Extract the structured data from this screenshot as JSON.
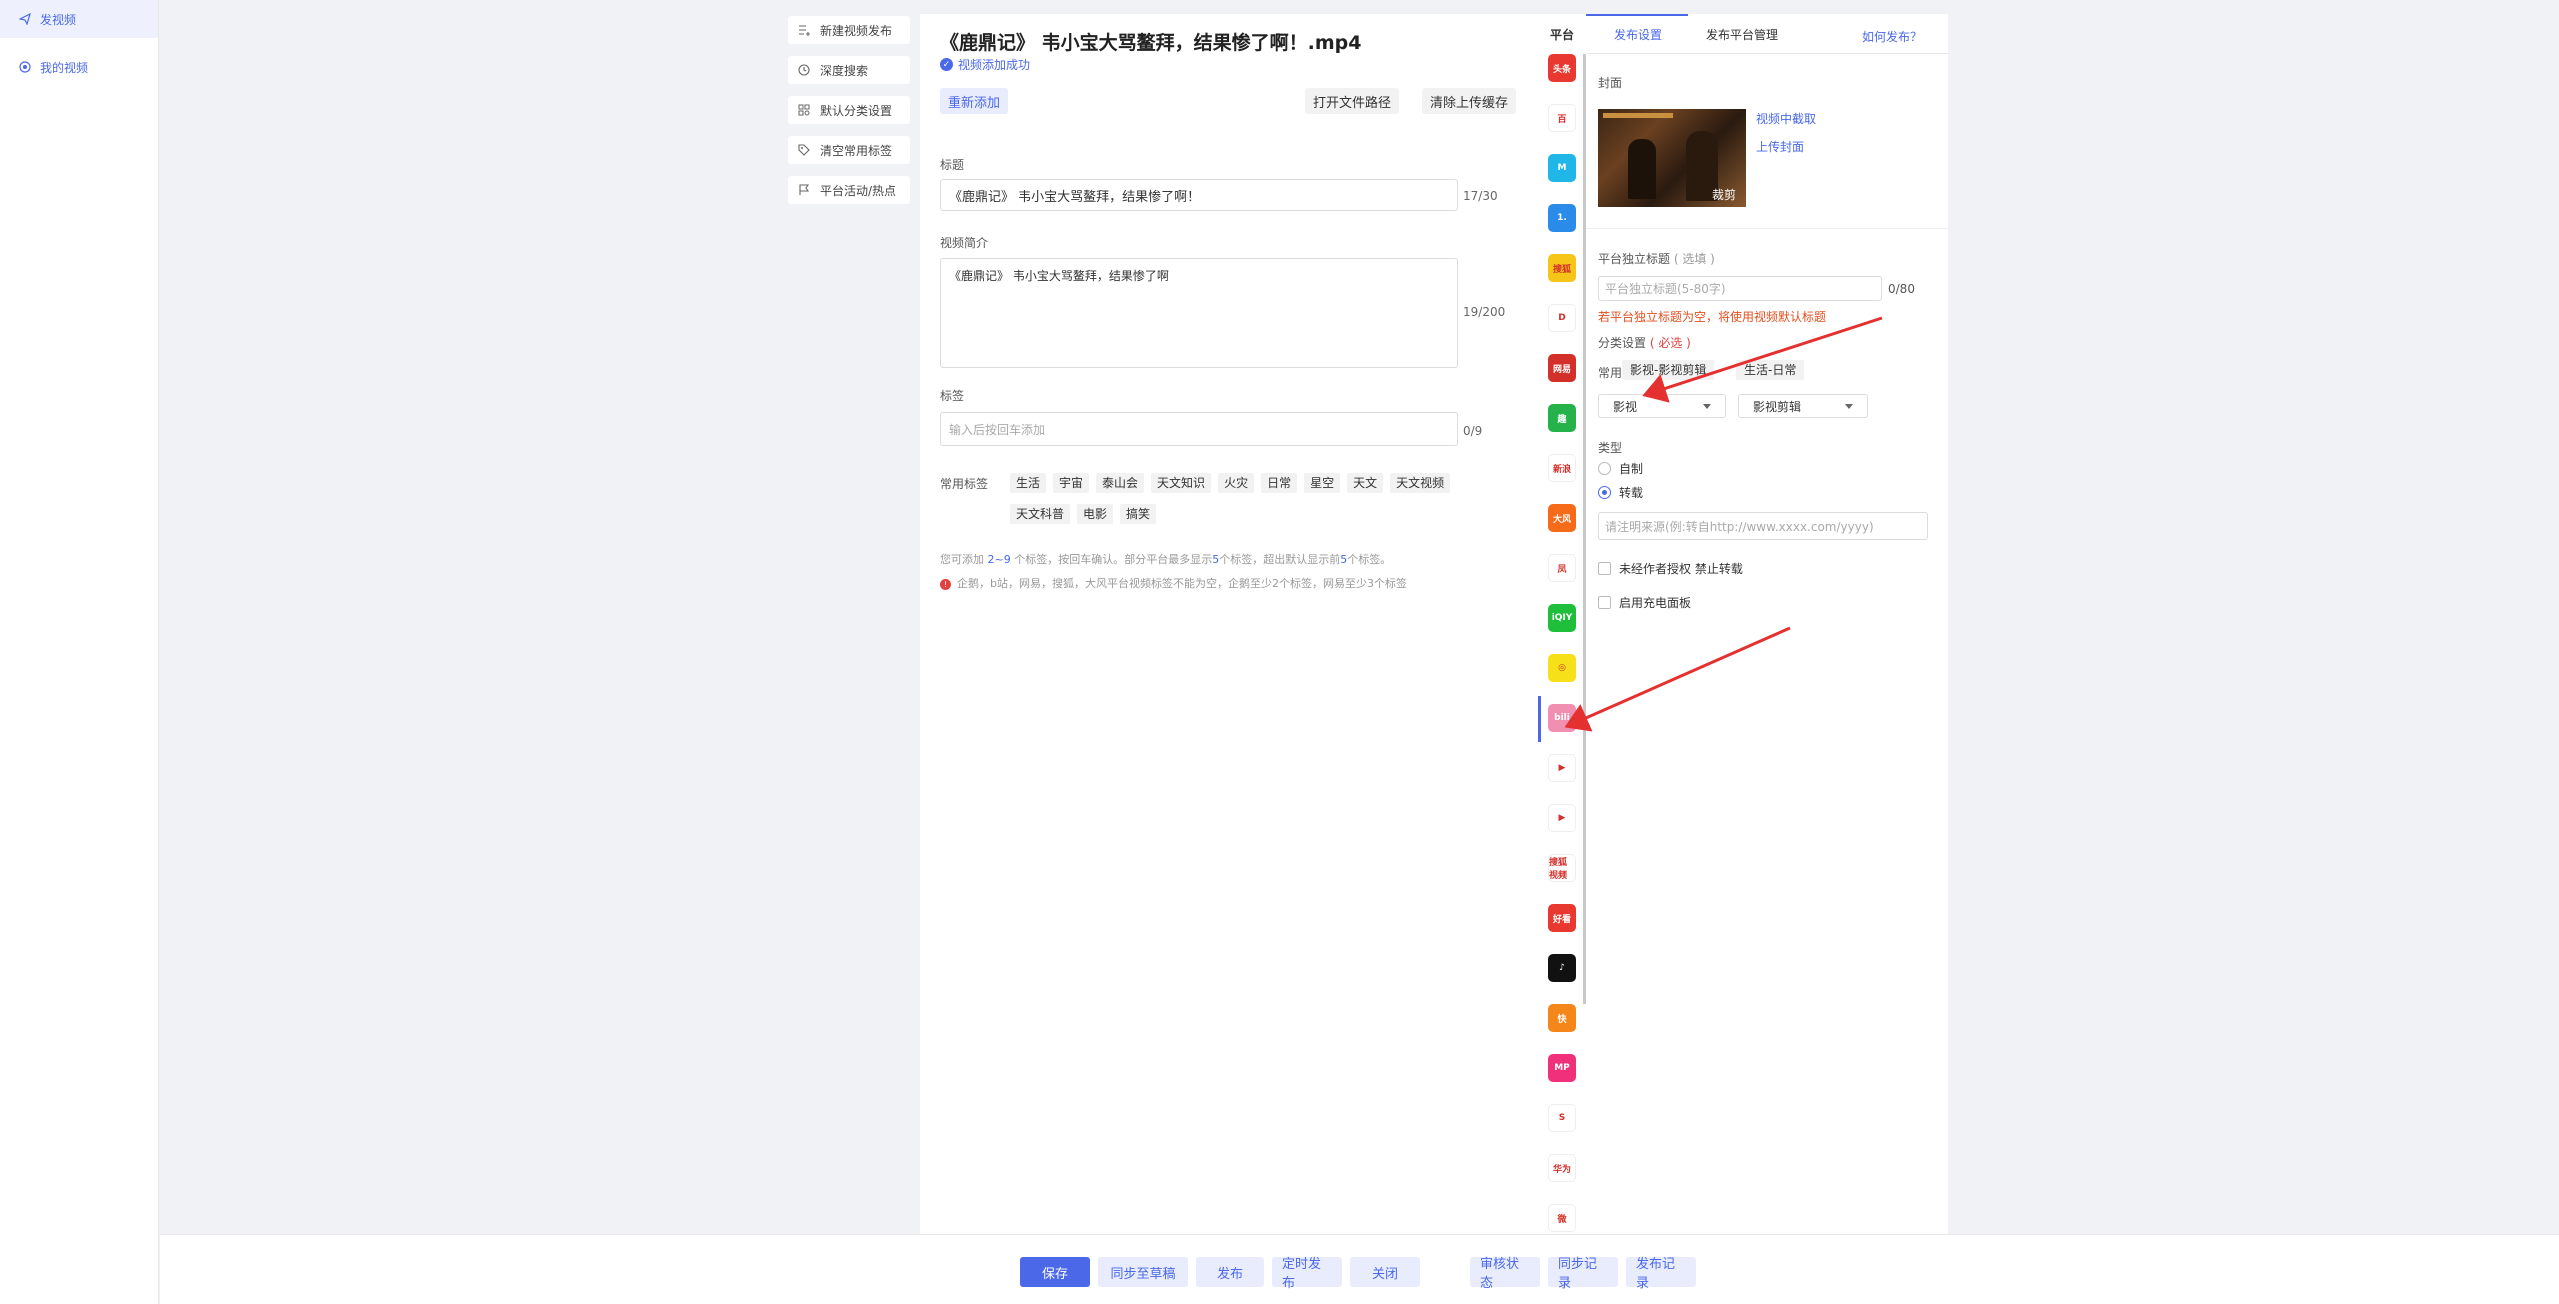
{
  "sidebar": {
    "items": [
      {
        "label": "发视频",
        "icon": "send-icon"
      },
      {
        "label": "我的视频",
        "icon": "target-icon"
      }
    ]
  },
  "tools": [
    {
      "label": "新建视频发布",
      "icon": "list-plus-icon"
    },
    {
      "label": "深度搜索",
      "icon": "history-icon"
    },
    {
      "label": "默认分类设置",
      "icon": "grid-icon"
    },
    {
      "label": "清空常用标签",
      "icon": "tag-icon"
    },
    {
      "label": "平台活动/热点",
      "icon": "flag-icon"
    }
  ],
  "main": {
    "video_title": "《鹿鼎记》 韦小宝大骂鳌拜，结果惨了啊！.mp4",
    "success_text": "视频添加成功",
    "readd_label": "重新添加",
    "open_path_label": "打开文件路径",
    "clear_cache_label": "清除上传缓存",
    "title_label": "标题",
    "title_value": "《鹿鼎记》 韦小宝大骂鳌拜，结果惨了啊！",
    "title_count": "17/30",
    "desc_label": "视频简介",
    "desc_value": "《鹿鼎记》 韦小宝大骂鳌拜，结果惨了啊",
    "desc_count": "19/200",
    "tags_label": "标签",
    "tags_placeholder": "输入后按回车添加",
    "tags_count": "0/9",
    "common_tags_label": "常用标签",
    "common_tags_row1": [
      "生活",
      "宇宙",
      "泰山会",
      "天文知识",
      "火灾",
      "日常",
      "星空",
      "天文",
      "天文视频"
    ],
    "common_tags_row2": [
      "天文科普",
      "电影",
      "搞笑"
    ],
    "hint1_a": "您可添加 ",
    "hint1_b": "2~9",
    "hint1_c": " 个标签，按回车确认。部分平台最多显示",
    "hint1_d": "5",
    "hint1_e": "个标签，超出默认显示前",
    "hint1_f": "5",
    "hint1_g": "个标签。",
    "hint2": "企鹅，b站，网易，搜狐，大风平台视频标签不能为空，企鹅至少2个标签，网易至少3个标签"
  },
  "platforms": {
    "header": "平台",
    "icons": [
      {
        "name": "toutiao-icon",
        "text": "头条",
        "color": "#e8382f"
      },
      {
        "name": "baijia-icon",
        "text": "百",
        "color": "#ffffff"
      },
      {
        "name": "dayu-icon",
        "text": "M",
        "color": "#1fb6e8"
      },
      {
        "name": "yidian-icon",
        "text": "1.",
        "color": "#2a8be8"
      },
      {
        "name": "sohu-icon",
        "text": "搜狐",
        "color": "#f5c518"
      },
      {
        "name": "weibo-oval-icon",
        "text": "D",
        "color": "#ffffff"
      },
      {
        "name": "netease-icon",
        "text": "网易",
        "color": "#d4302a"
      },
      {
        "name": "qutoutiao-icon",
        "text": "趣",
        "color": "#26b24b"
      },
      {
        "name": "xinlang-icon",
        "text": "新浪",
        "color": "#ffffff"
      },
      {
        "name": "dafeng-icon",
        "text": "大风",
        "color": "#f56b1a"
      },
      {
        "name": "ifeng-icon",
        "text": "凤",
        "color": "#ffffff"
      },
      {
        "name": "iqiyi-icon",
        "text": "iQIY",
        "color": "#1fbf3b"
      },
      {
        "name": "eye-icon",
        "text": "◎",
        "color": "#f5e01a"
      },
      {
        "name": "bilibili-icon",
        "text": "bili",
        "color": "#f08fb0"
      },
      {
        "name": "play-store-icon",
        "text": "▶",
        "color": "#ffffff"
      },
      {
        "name": "youku-icon",
        "text": "▶",
        "color": "#ffffff"
      },
      {
        "name": "sohu-video-icon",
        "text": "搜狐视频",
        "color": "#ffffff"
      },
      {
        "name": "haokan-icon",
        "text": "好看",
        "color": "#e8382f"
      },
      {
        "name": "douyin-icon",
        "text": "♪",
        "color": "#111111"
      },
      {
        "name": "kuaishou-icon",
        "text": "快",
        "color": "#f5871a"
      },
      {
        "name": "meipai-icon",
        "text": "MP",
        "color": "#f0307a"
      },
      {
        "name": "sina-s-icon",
        "text": "S",
        "color": "#ffffff"
      },
      {
        "name": "huawei-icon",
        "text": "华为",
        "color": "#ffffff"
      },
      {
        "name": "weibo-icon",
        "text": "微",
        "color": "#ffffff"
      }
    ]
  },
  "settings": {
    "tab_publish": "发布设置",
    "tab_manage": "发布平台管理",
    "how_link": "如何发布？",
    "cover_label": "封面",
    "cover_cut": "裁剪",
    "cover_capture": "视频中截取",
    "cover_upload": "上传封面",
    "standalone_title_label": "平台独立标题",
    "standalone_title_optional": "( 选填 )",
    "standalone_placeholder": "平台独立标题(5-80字)",
    "standalone_count": "0/80",
    "standalone_warn": "若平台独立标题为空，将使用视频默认标题",
    "category_label": "分类设置",
    "category_required": "( 必选 )",
    "common_label": "常用",
    "common_chip1": "影视-影视剪辑",
    "common_chip2": "生活-日常",
    "select1": "影视",
    "select2": "影视剪辑",
    "type_label": "类型",
    "type_original": "自制",
    "type_repost": "转载",
    "source_placeholder": "请注明来源(例:转自http://www.xxxx.com/yyyy)",
    "no_auth_label": "未经作者授权 禁止转载",
    "charge_label": "启用充电面板"
  },
  "bottom": {
    "save": "保存",
    "sync_draft": "同步至草稿",
    "publish": "发布",
    "schedule": "定时发布",
    "close": "关闭",
    "review": "审核状态",
    "sync_record": "同步记录",
    "publish_record": "发布记录"
  },
  "colors": {
    "accent": "#4a68e8",
    "warn": "#e05020",
    "arrow": "#e53030"
  }
}
